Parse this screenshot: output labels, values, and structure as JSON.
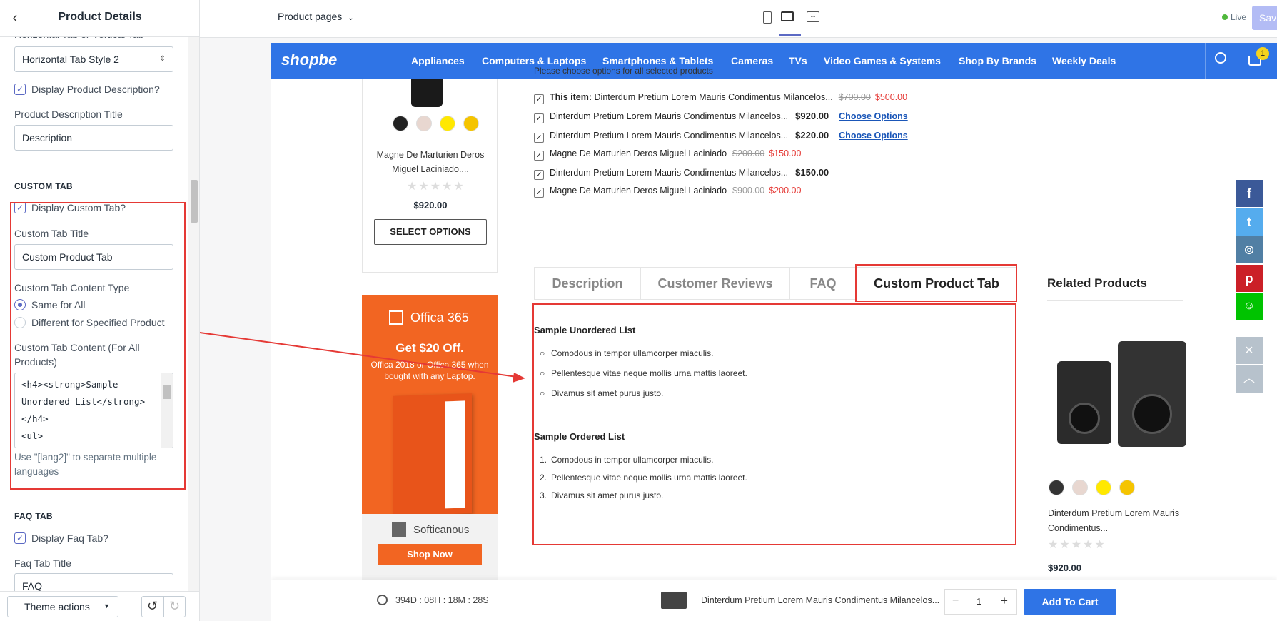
{
  "sidebar": {
    "title": "Product Details",
    "tab_style_label": "Horizontal Tab or Vertical Tab",
    "tab_style_value": "Horizontal Tab Style 2",
    "display_description_label": "Display Product Description?",
    "description_title_label": "Product Description Title",
    "description_title_value": "Description",
    "custom_tab_section": "CUSTOM TAB",
    "display_custom_tab_label": "Display Custom Tab?",
    "custom_tab_title_label": "Custom Tab Title",
    "custom_tab_title_value": "Custom Product Tab",
    "content_type_label": "Custom Tab Content Type",
    "content_type_options": [
      "Same for All",
      "Different for Specified Product"
    ],
    "content_label_line1": "Custom Tab Content (For All",
    "content_label_line2": "Products)",
    "content_lines": [
      "<h4><strong>Sample",
      "Unordered List</strong>",
      "</h4>",
      "<ul>"
    ],
    "help_line1": "Use \"[lang2]\" to separate multiple",
    "help_line2": "languages",
    "faq_section": "FAQ TAB",
    "display_faq_label": "Display Faq Tab?",
    "faq_title_label": "Faq Tab Title",
    "faq_title_value": "FAQ",
    "theme_actions": "Theme actions"
  },
  "topbar": {
    "page_select": "Product pages",
    "live": "Live",
    "save": "Sav"
  },
  "store": {
    "logo": "shopbe",
    "nav": [
      "Appliances",
      "Computers & Laptops",
      "Smartphones & Tablets",
      "Cameras",
      "TVs",
      "Video Games & Systems",
      "Shop By Brands",
      "Weekly Deals"
    ],
    "cart_count": "1",
    "left_product": {
      "name_line1": "Magne De Marturien Deros",
      "name_line2": "Miguel Laciniado....",
      "price": "$920.00",
      "button": "SELECT OPTIONS"
    },
    "promo": {
      "brand": "Offica 365",
      "headline": "Get $20 Off.",
      "sub_line1": "Offica 2018 or Offica 365 when",
      "sub_line2": "bought with any Laptop.",
      "vendor": "Softicanous",
      "button": "Shop Now"
    },
    "fbt_note": "Please choose options for all selected products",
    "fbt": [
      {
        "prefix": "This item:",
        "name": "Dinterdum Pretium Lorem Mauris Condimentus Milancelos...",
        "old": "$700.00",
        "price": "$500.00",
        "choose": ""
      },
      {
        "prefix": "",
        "name": "Dinterdum Pretium Lorem Mauris Condimentus Milancelos...",
        "old": "",
        "price": "$920.00",
        "choose": "Choose Options"
      },
      {
        "prefix": "",
        "name": "Dinterdum Pretium Lorem Mauris Condimentus Milancelos...",
        "old": "",
        "price": "$220.00",
        "choose": "Choose Options"
      },
      {
        "prefix": "",
        "name": "Magne De Marturien Deros Miguel Laciniado",
        "old": "$200.00",
        "price": "$150.00",
        "choose": ""
      },
      {
        "prefix": "",
        "name": "Dinterdum Pretium Lorem Mauris Condimentus Milancelos...",
        "old": "",
        "price": "$150.00",
        "choose": ""
      },
      {
        "prefix": "",
        "name": "Magne De Marturien Deros Miguel Laciniado",
        "old": "$900.00",
        "price": "$200.00",
        "choose": ""
      }
    ],
    "tabs": [
      "Description",
      "Customer Reviews",
      "FAQ",
      "Custom Product Tab"
    ],
    "tab_content": {
      "ul_title": "Sample Unordered List",
      "ul_items": [
        "Comodous in tempor ullamcorper miaculis.",
        "Pellentesque vitae neque mollis urna mattis laoreet.",
        "Divamus sit amet purus justo."
      ],
      "ol_title": "Sample Ordered List",
      "ol_items": [
        "Comodous in tempor ullamcorper miaculis.",
        "Pellentesque vitae neque mollis urna mattis laoreet.",
        "Divamus sit amet purus justo."
      ]
    },
    "related": {
      "title": "Related Products",
      "name_line1": "Dinterdum Pretium Lorem Mauris",
      "name_line2": "Condimentus...",
      "price": "$920.00"
    },
    "sticky": {
      "countdown": "394D : 08H : 18M : 28S",
      "product": "Dinterdum Pretium Lorem Mauris Condimentus Milancelos...",
      "qty": "1",
      "button": "Add To Cart"
    }
  },
  "colors": {
    "accent": "#2f74e6",
    "promo": "#f26522",
    "annotation": "#e53935"
  }
}
